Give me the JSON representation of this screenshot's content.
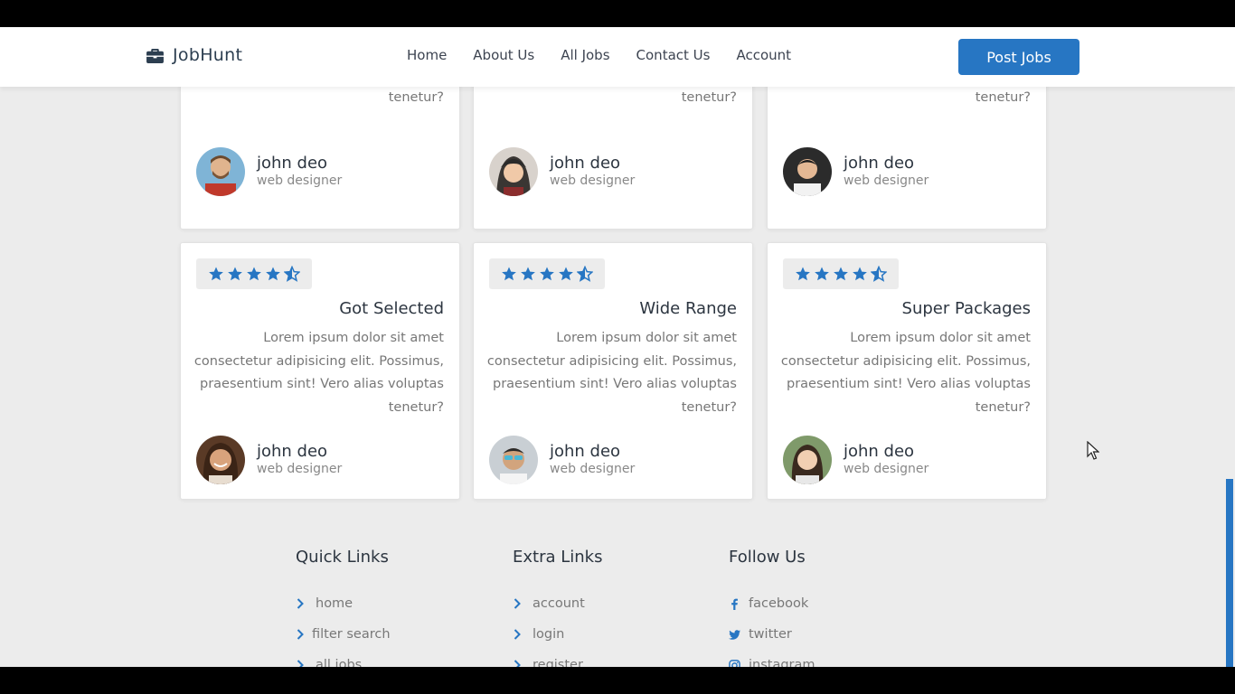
{
  "brand": {
    "name": "JobHunt",
    "icon": "briefcase-icon"
  },
  "nav": {
    "links": [
      "Home",
      "About Us",
      "All Jobs",
      "Contact Us",
      "Account"
    ],
    "cta": "Post Jobs"
  },
  "colors": {
    "accent": "#2776c3",
    "page_bg": "#ececec"
  },
  "reviews_top": [
    {
      "text": "consectetur adipisicing elit. Possimus, praesentium sint! Vero alias voluptas tenetur?",
      "name": "john deo",
      "role": "web designer"
    },
    {
      "text": "consectetur adipisicing elit. Possimus, praesentium sint! Vero alias voluptas tenetur?",
      "name": "john deo",
      "role": "web designer"
    },
    {
      "text": "consectetur adipisicing elit. Possimus, praesentium sint! Vero alias voluptas tenetur?",
      "name": "john deo",
      "role": "web designer"
    }
  ],
  "reviews": [
    {
      "rating": 4.5,
      "title": "Got Selected",
      "text": "Lorem ipsum dolor sit amet consectetur adipisicing elit. Possimus, praesentium sint! Vero alias voluptas tenetur?",
      "name": "john deo",
      "role": "web designer"
    },
    {
      "rating": 4.5,
      "title": "Wide Range",
      "text": "Lorem ipsum dolor sit amet consectetur adipisicing elit. Possimus, praesentium sint! Vero alias voluptas tenetur?",
      "name": "john deo",
      "role": "web designer"
    },
    {
      "rating": 4.5,
      "title": "Super Packages",
      "text": "Lorem ipsum dolor sit amet consectetur adipisicing elit. Possimus, praesentium sint! Vero alias voluptas tenetur?",
      "name": "john deo",
      "role": "web designer"
    }
  ],
  "footer": {
    "quick": {
      "title": "Quick Links",
      "items": [
        "home",
        "filter search",
        "all jobs"
      ]
    },
    "extra": {
      "title": "Extra Links",
      "items": [
        "account",
        "login",
        "register"
      ]
    },
    "follow": {
      "title": "Follow Us",
      "items": [
        {
          "label": "facebook",
          "icon": "facebook-icon"
        },
        {
          "label": "twitter",
          "icon": "twitter-icon"
        },
        {
          "label": "instagram",
          "icon": "instagram-icon"
        }
      ]
    }
  }
}
